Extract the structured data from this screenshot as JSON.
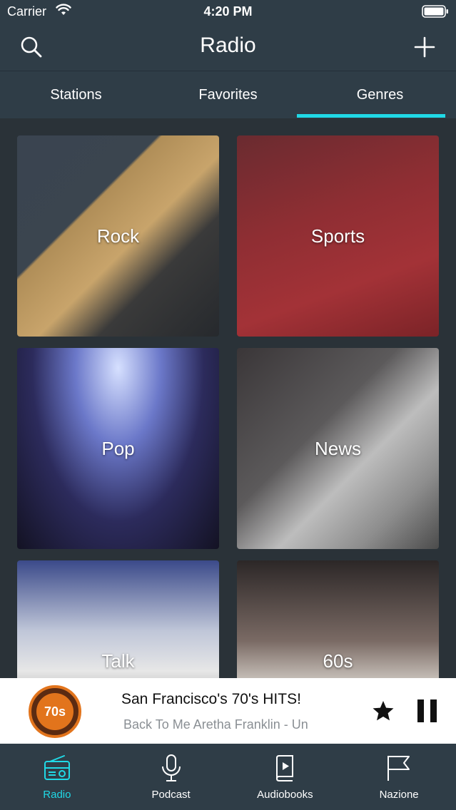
{
  "status_bar": {
    "carrier": "Carrier",
    "time": "4:20 PM"
  },
  "nav": {
    "title": "Radio"
  },
  "tabs": [
    {
      "label": "Stations"
    },
    {
      "label": "Favorites"
    },
    {
      "label": "Genres",
      "active": true
    }
  ],
  "genres": [
    {
      "label": "Rock"
    },
    {
      "label": "Sports"
    },
    {
      "label": "Pop"
    },
    {
      "label": "News"
    },
    {
      "label": "Talk"
    },
    {
      "label": "60s"
    }
  ],
  "player": {
    "title": "San Francisco's 70's HITS!",
    "track": "e Back To Me  Aretha Franklin - Un",
    "logo_text": "70s"
  },
  "tabbar": [
    {
      "label": "Radio",
      "icon": "radio-icon",
      "active": true
    },
    {
      "label": "Podcast",
      "icon": "microphone-icon"
    },
    {
      "label": "Audiobooks",
      "icon": "audiobook-icon"
    },
    {
      "label": "Nazione",
      "icon": "flag-icon"
    }
  ],
  "colors": {
    "accent": "#20d9e6",
    "bar_bg": "#2f3d47",
    "content_bg": "#2a3238"
  }
}
